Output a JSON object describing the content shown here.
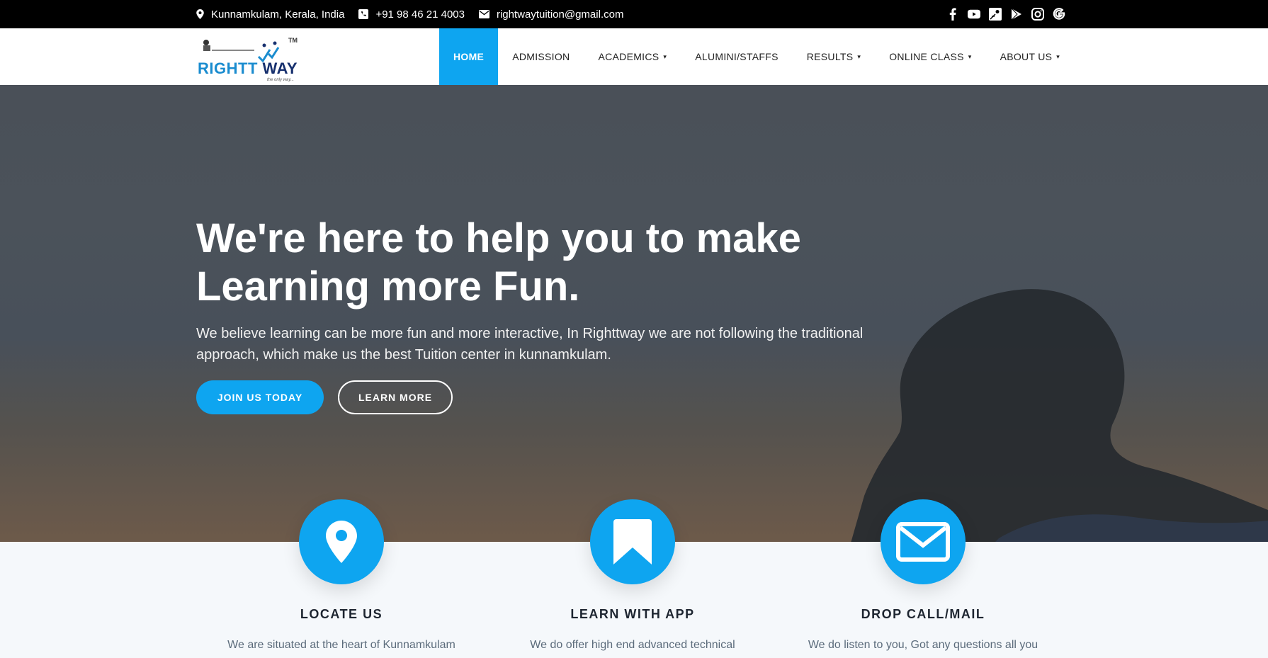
{
  "topbar": {
    "location": "Kunnamkulam, Kerala, India",
    "phone": "+91 98 46 21 4003",
    "email": "rightwaytuition@gmail.com",
    "socials": [
      "facebook-icon",
      "youtube-icon",
      "maps-icon",
      "play-store-icon",
      "instagram-icon",
      "google-icon"
    ]
  },
  "logo": {
    "brand_a": "RIGHTT",
    "brand_b": "WAY",
    "tm": "TM",
    "tagline": "the only way..."
  },
  "nav": {
    "items": [
      {
        "label": "HOME",
        "active": true
      },
      {
        "label": "ADMISSION"
      },
      {
        "label": "ACADEMICS",
        "dropdown": true
      },
      {
        "label": "ALUMINI/STAFFS"
      },
      {
        "label": "RESULTS",
        "dropdown": true
      },
      {
        "label": "ONLINE CLASS",
        "dropdown": true
      },
      {
        "label": "ABOUT US",
        "dropdown": true
      }
    ],
    "caret": "▾"
  },
  "hero": {
    "title_line1": "We're here to help you to make",
    "title_line2": "Learning more Fun.",
    "subtitle": "We believe learning can be more fun and more interactive, In Righttway we are not following the traditional approach, which make us the best Tuition center in kunnamkulam.",
    "primary_button": "JOIN US TODAY",
    "secondary_button": "LEARN MORE"
  },
  "features": [
    {
      "icon": "map-pin-icon",
      "title": "LOCATE US",
      "text": "We are situated at the heart of Kunnamkulam"
    },
    {
      "icon": "bookmark-icon",
      "title": "LEARN WITH APP",
      "text": "We do offer high end advanced technical"
    },
    {
      "icon": "envelope-icon",
      "title": "DROP CALL/MAIL",
      "text": "We do listen to you, Got any questions all you"
    }
  ],
  "colors": {
    "accent": "#0ea5f0",
    "topbar": "#000000",
    "feature_bg": "#f5f8fb"
  }
}
